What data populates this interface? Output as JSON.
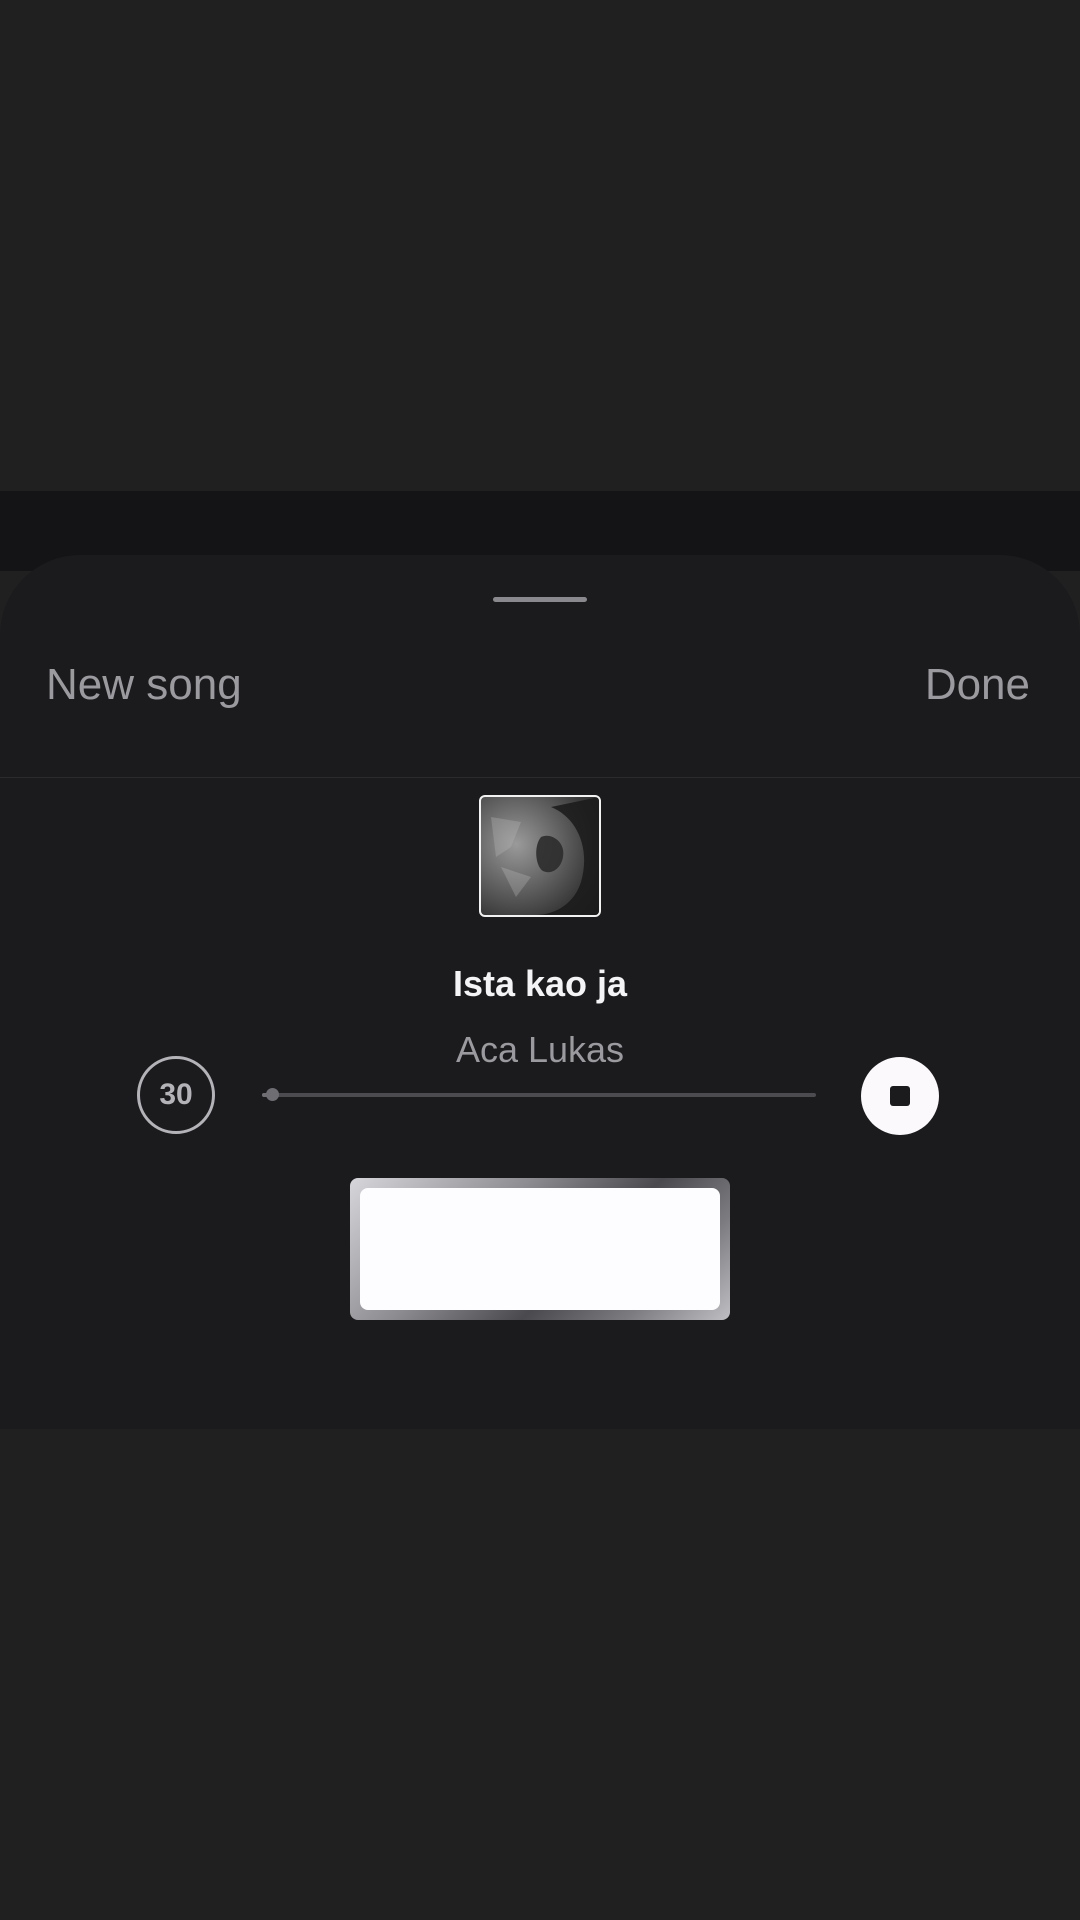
{
  "sheet": {
    "new_song_label": "New song",
    "done_label": "Done"
  },
  "track": {
    "title": "Ista kao ja",
    "artist": "Aca Lukas",
    "duration_seconds": "30",
    "progress_fraction": 0.01
  },
  "icons": {
    "album_art": "album-cover-image",
    "stop": "stop-icon"
  },
  "colors": {
    "background": "#202020",
    "sheet": "#1b1a1d",
    "primary_text": "#f4f4f6",
    "secondary_text": "#9b9a9e",
    "stop_button": "#fbf9fc"
  }
}
